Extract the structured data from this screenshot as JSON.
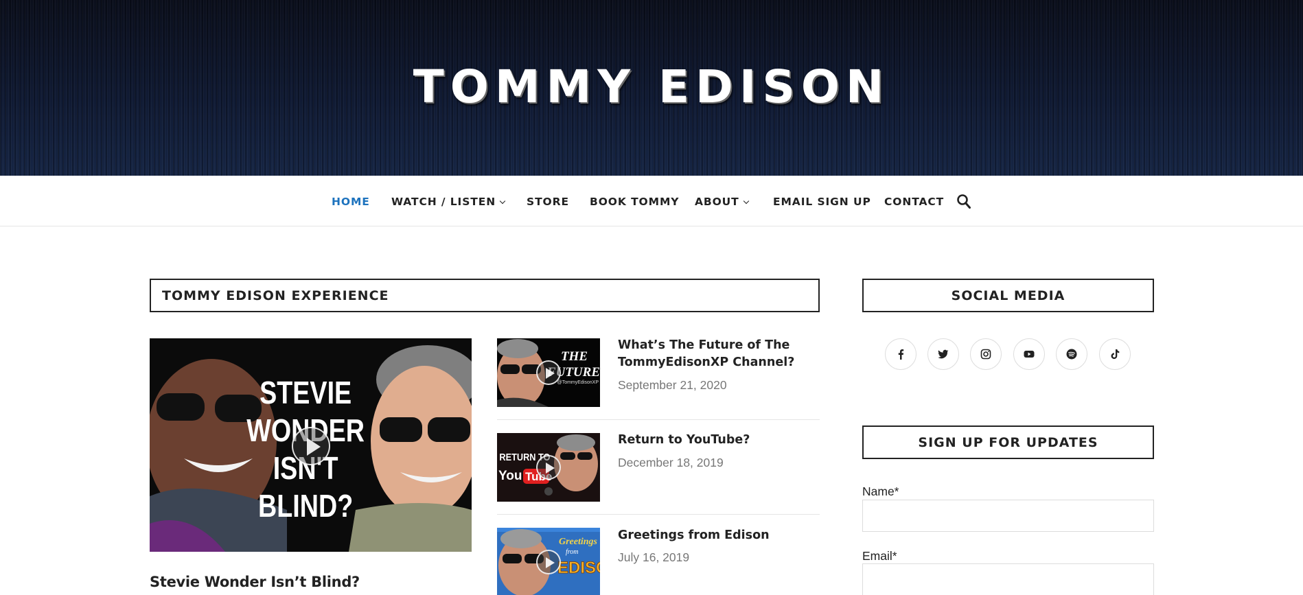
{
  "header": {
    "site_title": "TOMMY EDISON"
  },
  "nav": {
    "home": "HOME",
    "watch_listen": "WATCH / LISTEN",
    "store": "STORE",
    "book_tommy": "BOOK TOMMY",
    "about": "ABOUT",
    "email_signup": "EMAIL SIGN UP",
    "contact": "CONTACT",
    "active_color": "#1e73be"
  },
  "main": {
    "section_title": "TOMMY EDISON EXPERIENCE",
    "featured": {
      "thumb_text": "STEVIE WONDER ISN'T BLIND?",
      "title": "Stevie Wonder Isn’t Blind?"
    },
    "posts": [
      {
        "title": "What’s The Future of The TommyEdisonXP Channel?",
        "date": "September 21, 2020",
        "thumb_text": "THE FUTURE",
        "thumb_handle": "@TommyEdisonXP"
      },
      {
        "title": "Return to YouTube?",
        "date": "December 18, 2019",
        "thumb_text": "RETURN TO",
        "thumb_brand": "YouTube"
      },
      {
        "title": "Greetings from Edison",
        "date": "July 16, 2019",
        "thumb_text": "Greetings from",
        "thumb_brand": "EDISON"
      }
    ]
  },
  "sidebar": {
    "social_title": "SOCIAL MEDIA",
    "social_icons": [
      "facebook-icon",
      "twitter-icon",
      "instagram-icon",
      "youtube-icon",
      "spotify-icon",
      "tiktok-icon"
    ],
    "signup_title": "SIGN UP FOR UPDATES",
    "name_label": "Name*",
    "email_label": "Email*",
    "name_value": "",
    "email_value": ""
  }
}
